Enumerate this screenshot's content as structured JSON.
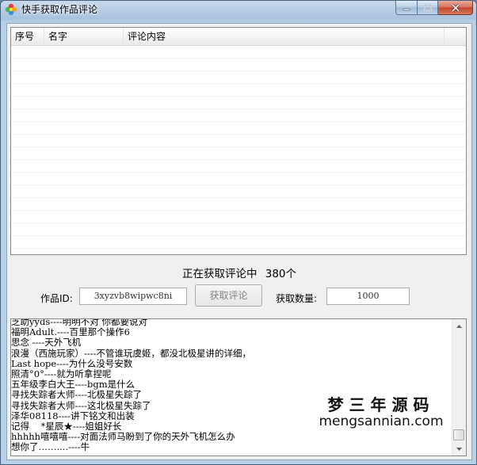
{
  "window": {
    "title": "快手获取作品评论",
    "icon": "kuaishou-flower-icon"
  },
  "list": {
    "columns": [
      "序号",
      "名字",
      "评论内容"
    ],
    "rows": []
  },
  "status": {
    "text": "正在获取评论中",
    "count": "380个"
  },
  "form": {
    "work_id_label": "作品ID:",
    "work_id_value": "3xyzvb8wipwc8ni",
    "fetch_button": "获取评论",
    "count_label": "获取数量:",
    "count_value": "1000"
  },
  "log": {
    "lines": [
      "芝助yyds----明明不对 你都要说对",
      "福明Adult.----百里那个操作6",
      "思念 ----天外飞机",
      "浪漫（西施玩家）----不管谁玩虞姬，都没北极星讲的详细，",
      "Last hope----为什么没号安数",
      "照清°0°----就为听拿捏呢",
      "五年级李白大王----bgm是什么",
      "寻找失踪者大师----北极星失踪了",
      "寻找失踪者大师----这北极星失踪了",
      "泽华08118----讲下铭文和出装",
      "记得    *星辰★----姐姐好长",
      "hhhhh嘻嘻嘻----对面法师马盼到了你的天外飞机怎么办",
      "想你了……....----牛"
    ]
  },
  "watermark": {
    "cn": "梦三年源码",
    "en": "mengsannian.com"
  },
  "colors": {
    "title_bar": "#b9cfe6",
    "close_button": "#c4442a",
    "client": "#f0f0f0"
  }
}
